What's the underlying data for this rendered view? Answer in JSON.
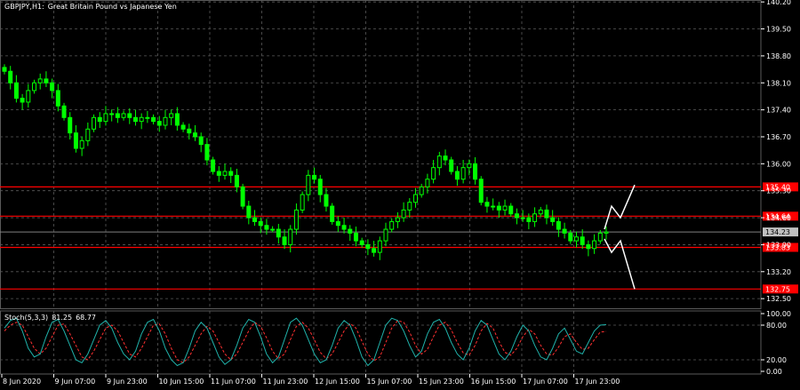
{
  "main_title": {
    "symbol": "GBPJPY,H1:",
    "description": "Great Britain Pound vs Japanese Yen"
  },
  "stoch_title": {
    "name": "Stoch(5,3,3)",
    "value_a": "81.25",
    "value_b": "68.77"
  },
  "colors": {
    "background": "#000000",
    "grid": "#5a5a5a",
    "candle": "#00ff00",
    "level_line": "#ff0000",
    "level_label_bg": "#ff0000",
    "current_price_line": "#808080",
    "arrow": "#ffffff",
    "stoch_main": "#20b2aa",
    "stoch_signal": "#ff3030",
    "text": "#ffffff"
  },
  "chart_data": {
    "type": "candlestick",
    "price_axis_ticks": [
      "140.20",
      "139.50",
      "138.80",
      "138.10",
      "137.40",
      "136.70",
      "136.00",
      "135.30",
      "134.60",
      "133.90",
      "133.20",
      "132.50"
    ],
    "ylim": [
      132.25,
      140.25
    ],
    "time_labels": [
      "8 Jun 2020",
      "9 Jun 07:00",
      "9 Jun 23:00",
      "10 Jun 15:00",
      "11 Jun 07:00",
      "11 Jun 23:00",
      "12 Jun 15:00",
      "15 Jun 07:00",
      "15 Jun 23:00",
      "16 Jun 15:00",
      "17 Jun 07:00",
      "17 Jun 23:00"
    ],
    "levels": [
      {
        "price": 135.4,
        "label": "135.40"
      },
      {
        "price": 134.64,
        "label": "134.64"
      },
      {
        "price": 133.83,
        "label": "133.83"
      },
      {
        "price": 132.75,
        "label": "132.75"
      }
    ],
    "current_price": {
      "price": 134.23,
      "label": "134.23"
    },
    "close": [
      138.4,
      138.1,
      137.7,
      137.6,
      137.9,
      138.1,
      138.2,
      138.1,
      137.9,
      137.5,
      137.2,
      136.8,
      136.4,
      136.6,
      136.9,
      137.2,
      137.1,
      137.3,
      137.3,
      137.2,
      137.3,
      137.2,
      137.1,
      137.2,
      137.2,
      137.1,
      137.0,
      137.2,
      137.3,
      137.0,
      136.9,
      136.8,
      136.7,
      136.5,
      136.1,
      135.8,
      135.7,
      135.8,
      135.7,
      135.4,
      134.9,
      134.6,
      134.5,
      134.4,
      134.3,
      134.3,
      134.1,
      133.9,
      134.3,
      134.8,
      135.2,
      135.7,
      135.6,
      135.2,
      134.9,
      134.5,
      134.4,
      134.3,
      134.2,
      134.0,
      133.9,
      133.8,
      133.7,
      134.0,
      134.3,
      134.5,
      134.6,
      134.8,
      135.0,
      135.2,
      135.4,
      135.6,
      135.9,
      136.2,
      136.1,
      135.8,
      135.6,
      135.9,
      136.0,
      135.6,
      135.0,
      134.9,
      134.9,
      134.8,
      134.9,
      134.7,
      134.6,
      134.6,
      134.5,
      134.7,
      134.8,
      134.6,
      134.5,
      134.3,
      134.2,
      134.0,
      134.1,
      133.9,
      133.8,
      134.0,
      134.2,
      134.23
    ],
    "indicator": {
      "name": "Stoch(5,3,3)",
      "levels": [
        "100.00",
        "80.00",
        "20.00",
        "0.00"
      ],
      "main": [
        75,
        88,
        92,
        70,
        40,
        25,
        30,
        60,
        85,
        90,
        70,
        45,
        20,
        15,
        30,
        55,
        80,
        88,
        75,
        50,
        30,
        20,
        35,
        65,
        85,
        90,
        70,
        40,
        20,
        10,
        15,
        40,
        70,
        85,
        75,
        50,
        25,
        12,
        20,
        45,
        75,
        90,
        85,
        60,
        30,
        15,
        25,
        55,
        85,
        92,
        80,
        55,
        30,
        15,
        20,
        45,
        75,
        88,
        80,
        55,
        25,
        10,
        20,
        50,
        80,
        92,
        88,
        70,
        45,
        25,
        35,
        65,
        85,
        90,
        75,
        50,
        30,
        20,
        40,
        70,
        88,
        80,
        55,
        30,
        20,
        35,
        60,
        80,
        70,
        45,
        25,
        20,
        40,
        65,
        75,
        55,
        35,
        30,
        50,
        70,
        80,
        81
      ],
      "signal": [
        70,
        80,
        85,
        80,
        60,
        40,
        30,
        40,
        60,
        80,
        82,
        65,
        45,
        25,
        20,
        35,
        55,
        75,
        80,
        70,
        50,
        30,
        25,
        40,
        60,
        80,
        82,
        65,
        40,
        20,
        15,
        25,
        45,
        65,
        78,
        70,
        50,
        30,
        20,
        30,
        50,
        70,
        85,
        78,
        58,
        35,
        22,
        30,
        55,
        78,
        85,
        75,
        55,
        33,
        22,
        30,
        50,
        70,
        83,
        75,
        52,
        30,
        18,
        25,
        50,
        75,
        88,
        85,
        68,
        45,
        30,
        38,
        60,
        80,
        85,
        72,
        50,
        32,
        28,
        45,
        70,
        83,
        75,
        52,
        33,
        28,
        40,
        60,
        73,
        65,
        45,
        30,
        28,
        42,
        60,
        65,
        50,
        38,
        40,
        55,
        68,
        69
      ]
    }
  }
}
